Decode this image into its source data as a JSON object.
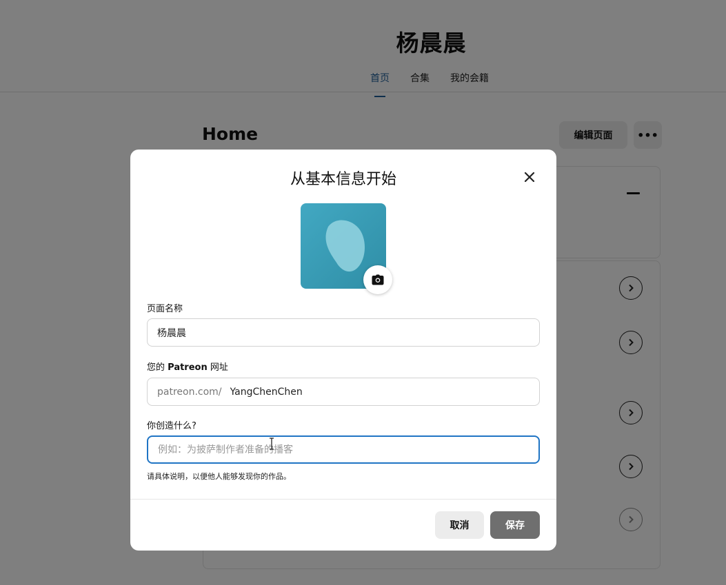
{
  "page": {
    "creator_name": "杨晨晨",
    "nav_tabs": [
      {
        "label": "首页",
        "active": true
      },
      {
        "label": "合集",
        "active": false
      },
      {
        "label": "我的会籍",
        "active": false
      }
    ],
    "section_title": "Home",
    "edit_page_label": "编辑页面",
    "more_label": "•••"
  },
  "modal": {
    "title": "从基本信息开始",
    "page_name_label": "页面名称",
    "page_name_value": "杨晨晨",
    "url_label_prefix": "您的 ",
    "url_label_brand": "Patreon",
    "url_label_suffix": " 网址",
    "url_prefix": "patreon.com/",
    "url_value": "YangChenChen",
    "create_label": "你创造什么?",
    "create_placeholder": "例如：为披萨制作者准备的播客",
    "create_value": "",
    "helper_text": "请具体说明，以便他人能够发现你的作品。",
    "cancel_label": "取消",
    "save_label": "保存"
  },
  "colors": {
    "accent": "#1f74c4",
    "avatar": "#3a9db5",
    "save_button": "#6f6f6f"
  },
  "icons": [
    "close-icon",
    "camera-icon",
    "chevron-right-icon",
    "minus-icon",
    "more-icon",
    "text-cursor-icon"
  ]
}
